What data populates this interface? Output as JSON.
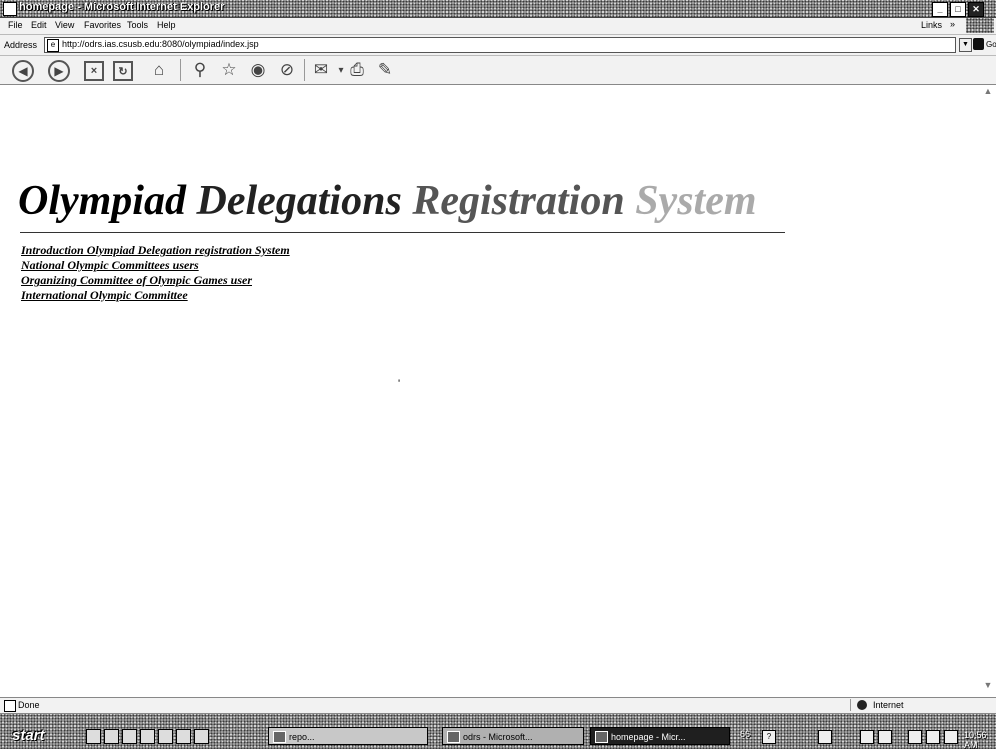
{
  "window": {
    "title": "homepage - Microsoft Internet Explorer"
  },
  "menubar": {
    "items": [
      "File",
      "Edit",
      "View",
      "Favorites",
      "Tools",
      "Help"
    ],
    "links_label": "Links"
  },
  "address": {
    "label": "Address",
    "url": "http://odrs.ias.csusb.edu:8080/olympiad/index.jsp",
    "go_label": "Go"
  },
  "toolbar": {
    "icons": [
      "back-icon",
      "forward-icon",
      "stop-icon",
      "refresh-icon",
      "home-icon",
      "search-icon",
      "favorites-icon",
      "media-icon",
      "history-icon",
      "mail-icon",
      "print-icon",
      "edit-icon"
    ]
  },
  "page": {
    "heading_words": [
      "Olympiad",
      "Delegations",
      "Registration",
      "System"
    ],
    "links": [
      "Introduction Olympiad Delegation registration System",
      "National Olympic Committees users",
      "Organizing Committee of Olympic Games user",
      "International Olympic Committee"
    ],
    "stray_mark": "'"
  },
  "statusbar": {
    "status": "Done",
    "zone": "Internet"
  },
  "taskbar": {
    "start_label": "start",
    "tasks": [
      "repo...",
      "odrs - Microsoft...",
      "homepage - Micr..."
    ],
    "tray_badge": "66",
    "clock": "10:56 AM"
  },
  "colors": {
    "title_bar": "#9a9a9a",
    "link_text": "#000000",
    "page_background": "#ffffff"
  }
}
